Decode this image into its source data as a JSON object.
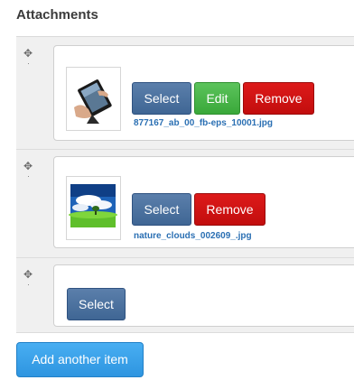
{
  "section": {
    "title": "Attachments"
  },
  "items": [
    {
      "thumbnail_icon": "tablet-hand-image",
      "buttons": {
        "select": "Select",
        "edit": "Edit",
        "remove": "Remove"
      },
      "filename": "877167_ab_00_fb-eps_10001.jpg"
    },
    {
      "thumbnail_icon": "landscape-clouds-image",
      "buttons": {
        "select": "Select",
        "remove": "Remove"
      },
      "filename": "nature_clouds_002609_.jpg"
    },
    {
      "buttons": {
        "select": "Select"
      }
    }
  ],
  "actions": {
    "add_another": "Add another item"
  },
  "colors": {
    "select": "#4a6f9c",
    "edit": "#4cb84c",
    "remove": "#d31414",
    "add": "#3aa1ea",
    "filename": "#2a6fb3"
  }
}
